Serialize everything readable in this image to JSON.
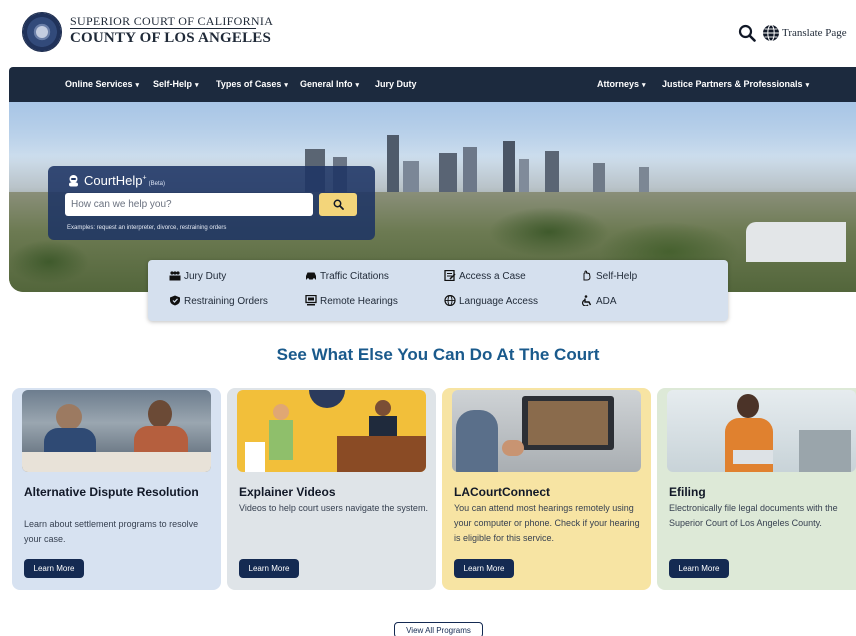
{
  "header": {
    "court_line1": "SUPERIOR COURT OF CALIFORNIA",
    "court_line2": "COUNTY OF LOS ANGELES",
    "translate_label": "Translate Page"
  },
  "nav": {
    "left": [
      {
        "label": "Online Services",
        "has_menu": true
      },
      {
        "label": "Self-Help",
        "has_menu": true
      },
      {
        "label": "Types of Cases",
        "has_menu": true
      },
      {
        "label": "General Info",
        "has_menu": true
      },
      {
        "label": "Jury Duty",
        "has_menu": false
      }
    ],
    "right": [
      {
        "label": "Attorneys",
        "has_menu": true
      },
      {
        "label": "Justice Partners & Professionals",
        "has_menu": true
      }
    ],
    "caret": "▾"
  },
  "courthelp": {
    "title": "CourtHelp",
    "sup": "+",
    "beta": "(Beta)",
    "placeholder": "How can we help you?",
    "examples": "Examples: request an interpreter, divorce, restraining orders"
  },
  "quick_links": [
    {
      "label": "Jury Duty",
      "icon": "jury-icon"
    },
    {
      "label": "Traffic Citations",
      "icon": "car-icon"
    },
    {
      "label": "Access a Case",
      "icon": "document-icon"
    },
    {
      "label": "Self-Help",
      "icon": "hand-icon"
    },
    {
      "label": "Restraining Orders",
      "icon": "shield-icon"
    },
    {
      "label": "Remote Hearings",
      "icon": "monitor-icon"
    },
    {
      "label": "Language Access",
      "icon": "globe-icon"
    },
    {
      "label": "ADA",
      "icon": "accessibility-icon"
    }
  ],
  "section_title": "See What Else You Can Do At The Court",
  "cards": [
    {
      "title": "Alternative Dispute Resolution",
      "text": "Learn about settlement programs to resolve your case.",
      "button": "Learn More",
      "bg": "#d7e2f1"
    },
    {
      "title": "Explainer Videos",
      "text": "Videos to help court users navigate the system.",
      "button": "Learn More",
      "bg": "#dfe4e8"
    },
    {
      "title": "LACourtConnect",
      "text": "You can attend most hearings remotely using your computer or phone. Check if your hearing is eligible for this service.",
      "button": "Learn More",
      "bg": "#f7e4a3"
    },
    {
      "title": "Efiling",
      "text": "Electronically file legal documents with the Superior Court of Los Angeles County.",
      "button": "Learn More",
      "bg": "#dde9d7"
    }
  ],
  "view_all_label": "View All Programs",
  "colors": {
    "nav_bg": "#1c2a3e",
    "accent_blue": "#1a5a8c",
    "button_navy": "#142a52",
    "search_button": "#f3d57a"
  }
}
